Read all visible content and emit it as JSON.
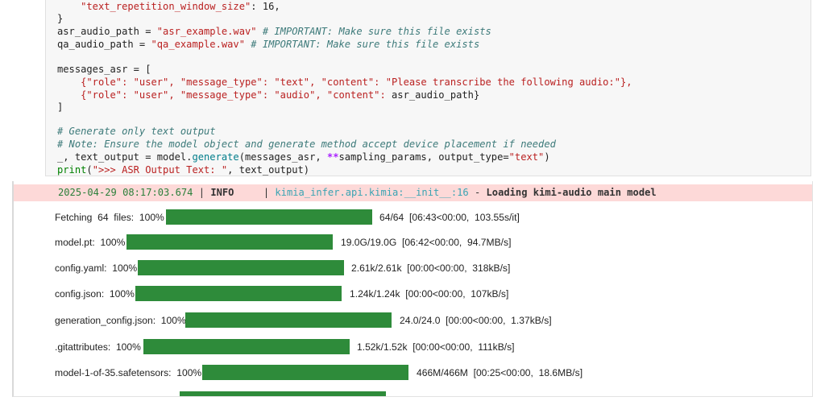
{
  "code": {
    "line1_key": "\"text_repetition_window_size\"",
    "line1_rest": ": 16,",
    "line2": "}",
    "asr_var": "asr_audio_path",
    "asr_eq": " = ",
    "asr_val": "\"asr_example.wav\"",
    "asr_comment": " # IMPORTANT: Make sure this file exists",
    "qa_var": "qa_audio_path",
    "qa_eq": " = ",
    "qa_val": "\"qa_example.wav\"",
    "qa_comment": " # IMPORTANT: Make sure this file exists",
    "msg_start": "messages_asr = [",
    "msg1": "    {\"role\": \"user\", \"message_type\": \"text\", \"content\": \"Please transcribe the following audio:\"},",
    "msg2_a": "    {\"role\": \"user\", \"message_type\": \"audio\", \"content\": ",
    "msg2_b": "asr_audio_path}",
    "msg_end": "]",
    "comment1": "# Generate only text output",
    "comment2": "# Note: Ensure the model object and generate method accept device placement if needed",
    "gen_a": "_, text_output = model.",
    "gen_fn": "generate",
    "gen_b": "(messages_asr, ",
    "gen_op": "**",
    "gen_c": "sampling_params, output_type=",
    "gen_str": "\"text\"",
    "gen_end": ")",
    "print_fn": "print",
    "print_a": "(",
    "print_str": "\">>> ASR Output Text: \"",
    "print_b": ", text_output)"
  },
  "log": {
    "time": "2025-04-29 08:17:03.674",
    "sep1": " | ",
    "level": "INFO    ",
    "sep2": " | ",
    "module": "kimia_infer.api.kimia:__init__:16",
    "sep3": " - ",
    "message": "Loading kimi-audio main model"
  },
  "progress": [
    {
      "label": "Fetching  64  files:  100%",
      "value": 1.0,
      "stats": "64/64  [06:43<00:00,  103.55s/it]"
    },
    {
      "label": "model.pt:  100%",
      "value": 1.0,
      "stats": "19.0G/19.0G  [06:42<00:00,  94.7MB/s]"
    },
    {
      "label": "config.yaml:  100%",
      "value": 1.0,
      "stats": "2.61k/2.61k  [00:00<00:00,  318kB/s]"
    },
    {
      "label": "config.json:  100%",
      "value": 1.0,
      "stats": "1.24k/1.24k  [00:00<00:00,  107kB/s]"
    },
    {
      "label": "generation_config.json:  100%",
      "value": 1.0,
      "stats": "24.0/24.0  [00:00<00:00,  1.37kB/s]"
    },
    {
      "label": ".gitattributes:  100%",
      "value": 1.0,
      "stats": "1.52k/1.52k  [00:00<00:00,  111kB/s]"
    },
    {
      "label": "model-1-of-35.safetensors:  100%",
      "value": 1.0,
      "stats": "466M/466M  [00:25<00:00,  18.6MB/s]"
    }
  ],
  "colors": {
    "bar": "#2e8b3a",
    "log_bg": "#fdd9d8"
  }
}
